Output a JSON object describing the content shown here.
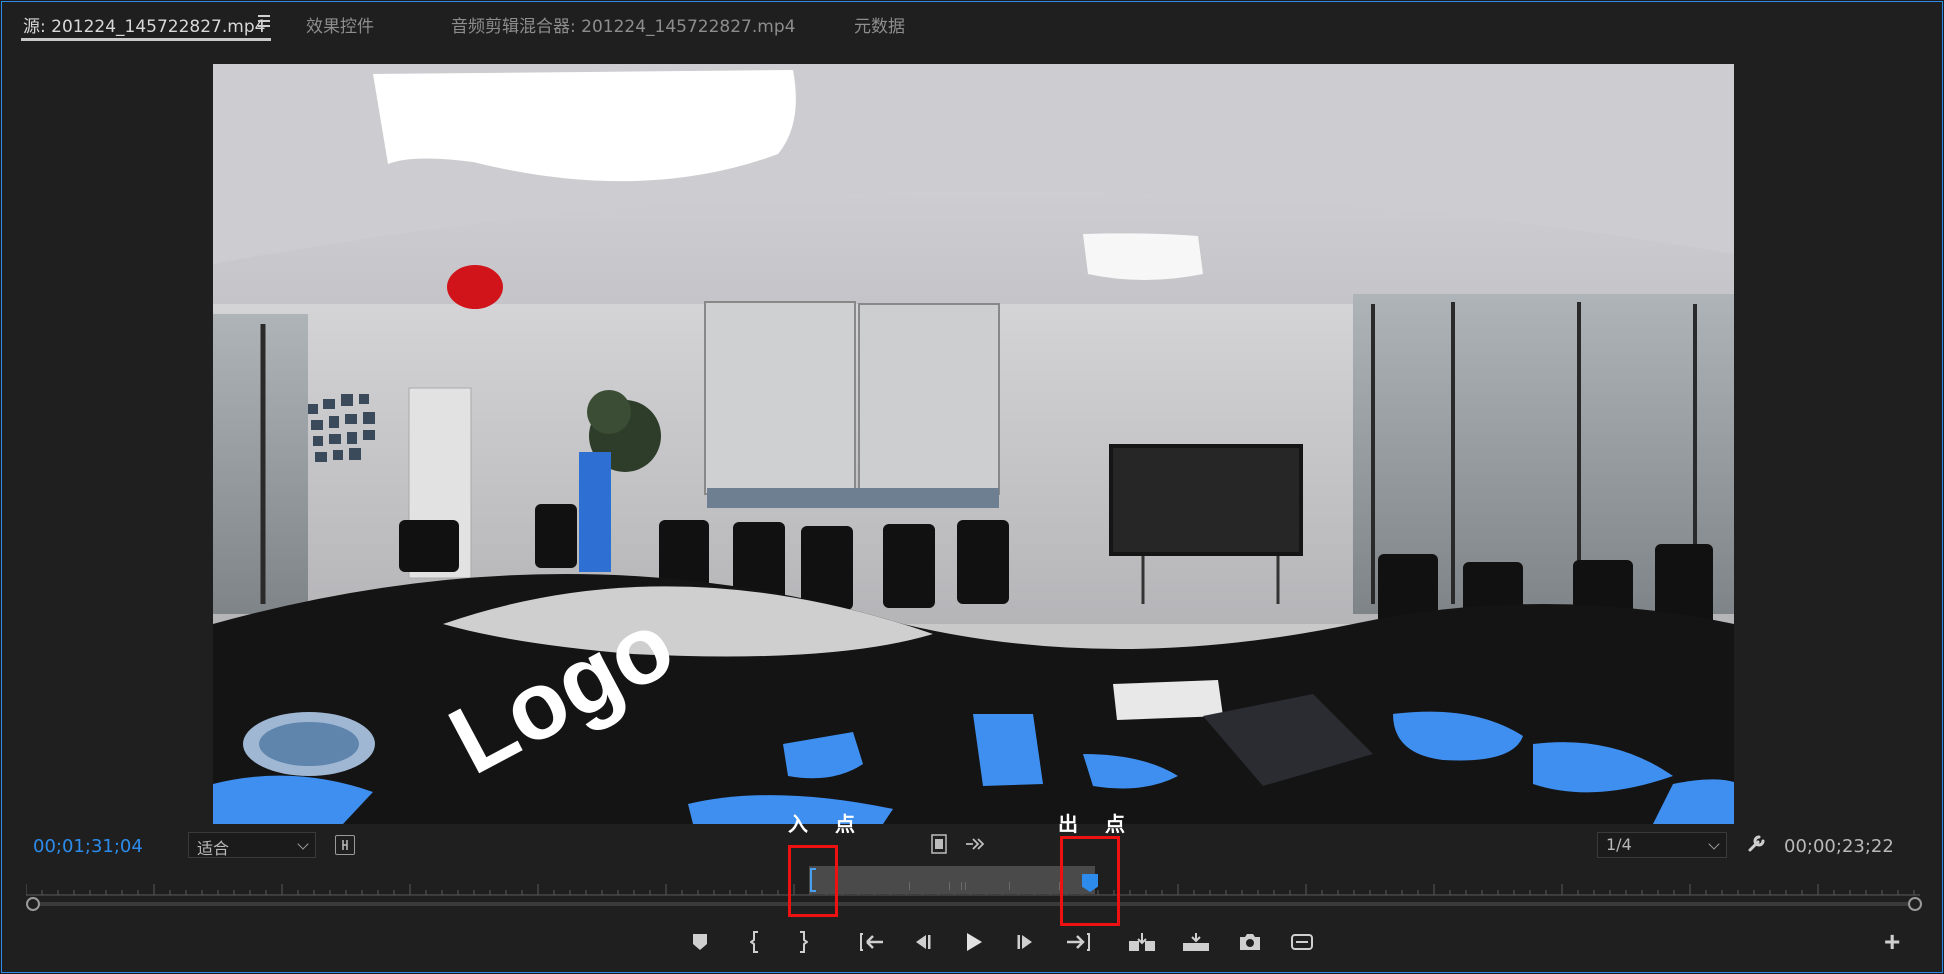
{
  "tabs": [
    {
      "label": "源: 201224_145722827.mp4",
      "active": true
    },
    {
      "label": "效果控件",
      "active": false
    },
    {
      "label": "音频剪辑混合器: 201224_145722827.mp4",
      "active": false
    },
    {
      "label": "元数据",
      "active": false
    }
  ],
  "controls": {
    "current_time": "00;01;31;04",
    "zoom_select": "适合",
    "resolution_select": "1/4",
    "duration_time": "00;00;23;22"
  },
  "annotations": {
    "in_point": "入 点",
    "out_point": "出 点"
  },
  "video_text": {
    "logo_word": "Logo"
  },
  "colors": {
    "accent": "#2d8ceb",
    "highlight_box": "#ee1111",
    "panel_bg": "#1f1f1f"
  },
  "icons": {
    "tab_menu": "hamburger-icon",
    "safe_margin": "bracket-icon",
    "drag_video": "filmstrip-icon",
    "drag_audio": "waveform-icon",
    "settings": "wrench-icon",
    "add_marker": "marker-icon",
    "mark_in": "mark-in-icon",
    "mark_out": "mark-out-icon",
    "go_to_in": "go-to-in-icon",
    "step_back": "step-back-icon",
    "play": "play-icon",
    "step_forward": "step-forward-icon",
    "go_to_out": "go-to-out-icon",
    "insert": "insert-icon",
    "overwrite": "overwrite-icon",
    "export_frame": "camera-icon",
    "vr_video": "vr-icon",
    "add_button": "plus-icon"
  }
}
